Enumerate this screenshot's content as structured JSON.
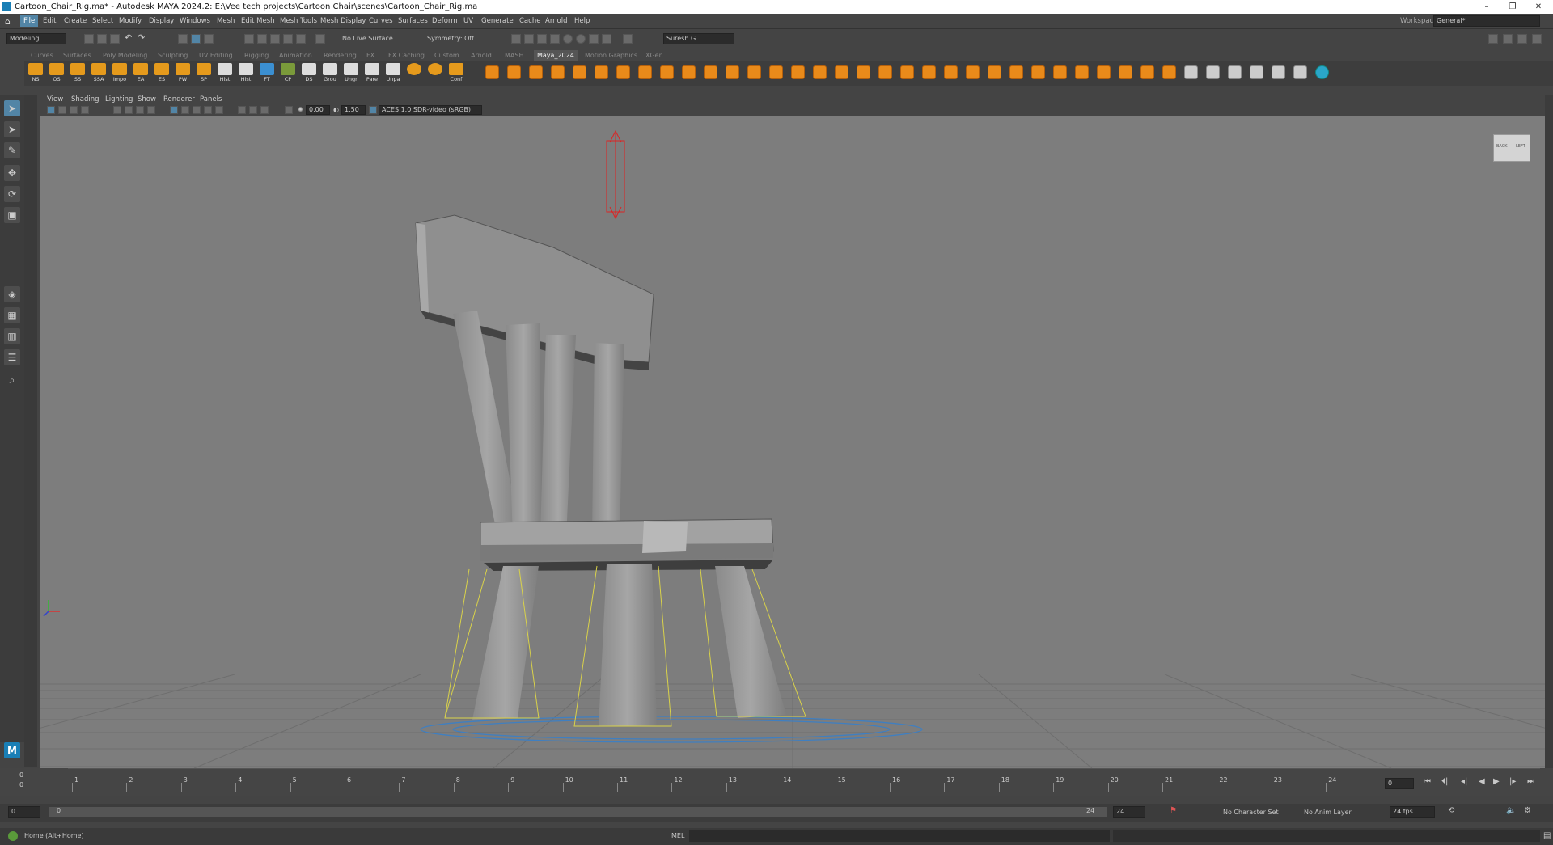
{
  "titlebar": {
    "title": "Cartoon_Chair_Rig.ma* - Autodesk MAYA 2024.2: E:\\Vee tech projects\\Cartoon Chair\\scenes\\Cartoon_Chair_Rig.ma",
    "minimize": "–",
    "maximize": "❐",
    "close": "✕"
  },
  "menus": [
    "File",
    "Edit",
    "Create",
    "Select",
    "Modify",
    "Display",
    "Windows",
    "Mesh",
    "Edit Mesh",
    "Mesh Tools",
    "Mesh Display",
    "Curves",
    "Surfaces",
    "Deform",
    "UV",
    "Generate",
    "Cache",
    "Arnold",
    "Help"
  ],
  "workspace": {
    "label": "Workspace:",
    "value": "General*"
  },
  "statusline": {
    "mode": "Modeling",
    "live_surface": "No Live Surface",
    "symmetry": "Symmetry: Off",
    "user": "Suresh G"
  },
  "shelf_tabs": [
    "Curves",
    "Surfaces",
    "Poly Modeling",
    "Sculpting",
    "UV Editing",
    "Rigging",
    "Animation",
    "Rendering",
    "FX",
    "FX Caching",
    "Custom",
    "Arnold",
    "MASH",
    "Maya_2024",
    "Motion Graphics",
    "XGen"
  ],
  "active_shelf_tab": "Maya_2024",
  "shelf_buttons": [
    "NS",
    "OS",
    "SS",
    "SSA",
    "Impo",
    "EA",
    "ES",
    "PW",
    "SP",
    "Hist",
    "Hist",
    "FT",
    "CP",
    "DS",
    "Grou",
    "Ungr",
    "Pare",
    "Unpa",
    "",
    "",
    "Conf"
  ],
  "viewport_menu": [
    "View",
    "Shading",
    "Lighting",
    "Show",
    "Renderer",
    "Panels"
  ],
  "viewport_toolbar": {
    "exposure": "0.00",
    "gamma": "1.50",
    "color_space": "ACES 1.0 SDR-video (sRGB)"
  },
  "viewcube": {
    "left": "BACK",
    "right": "LEFT"
  },
  "maya_logo": "M",
  "timeline": {
    "ticks": [
      "1",
      "2",
      "3",
      "4",
      "5",
      "6",
      "7",
      "8",
      "9",
      "10",
      "11",
      "12",
      "13",
      "14",
      "15",
      "16",
      "17",
      "18",
      "19",
      "20",
      "21",
      "22",
      "23",
      "24"
    ],
    "current_frame": "0",
    "frame_field": "0",
    "frame_field_2": "0"
  },
  "range": {
    "start": "0",
    "start_inner": "0",
    "end_inner": "24",
    "end": "24",
    "character_set": "No Character Set",
    "anim_layer": "No Anim Layer",
    "fps": "24 fps"
  },
  "cmdline": {
    "help": "Home (Alt+Home)",
    "lang": "MEL"
  }
}
